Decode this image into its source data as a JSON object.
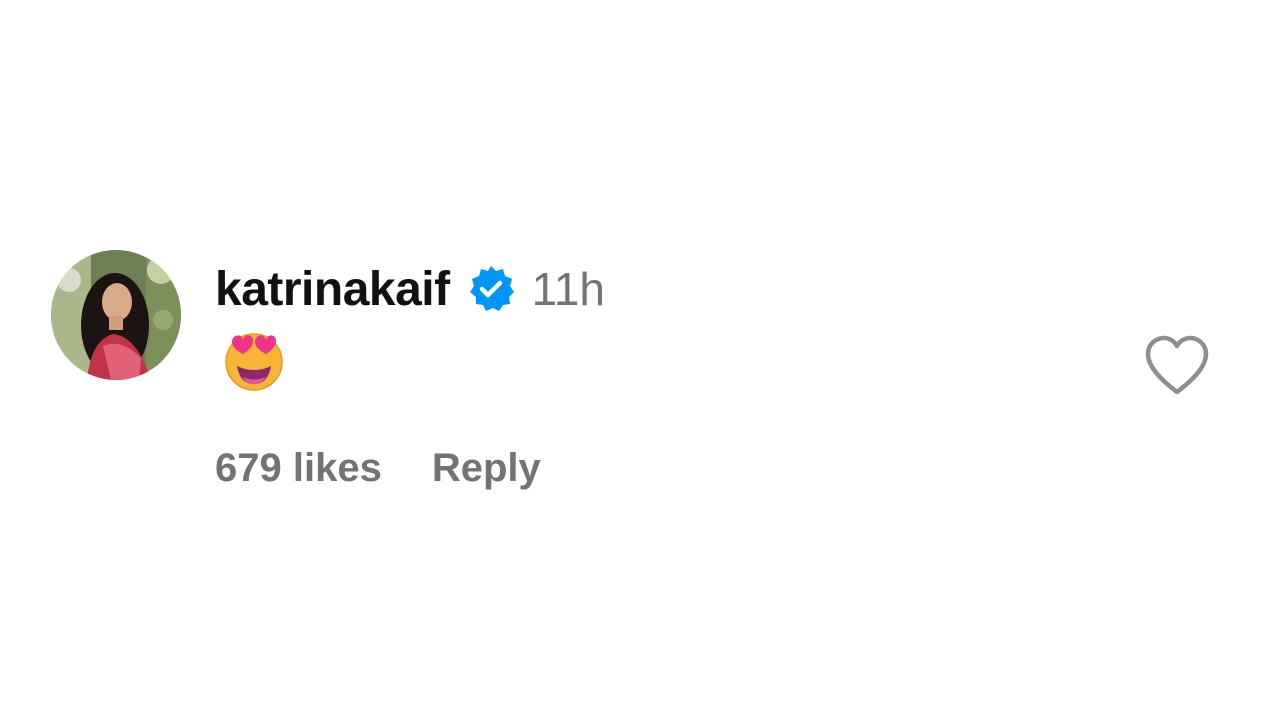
{
  "comment": {
    "username": "katrinakaif",
    "verified": true,
    "timestamp": "11h",
    "text_emoji": "smiling-face-with-heart-eyes",
    "likes_label": "679 likes",
    "reply_label": "Reply"
  },
  "icons": {
    "verified": "verified-badge-icon",
    "like": "heart-outline-icon"
  },
  "colors": {
    "username": "#111111",
    "muted": "#737373",
    "verified_blue": "#0095f6",
    "heart_outline": "#8e8e8e"
  }
}
